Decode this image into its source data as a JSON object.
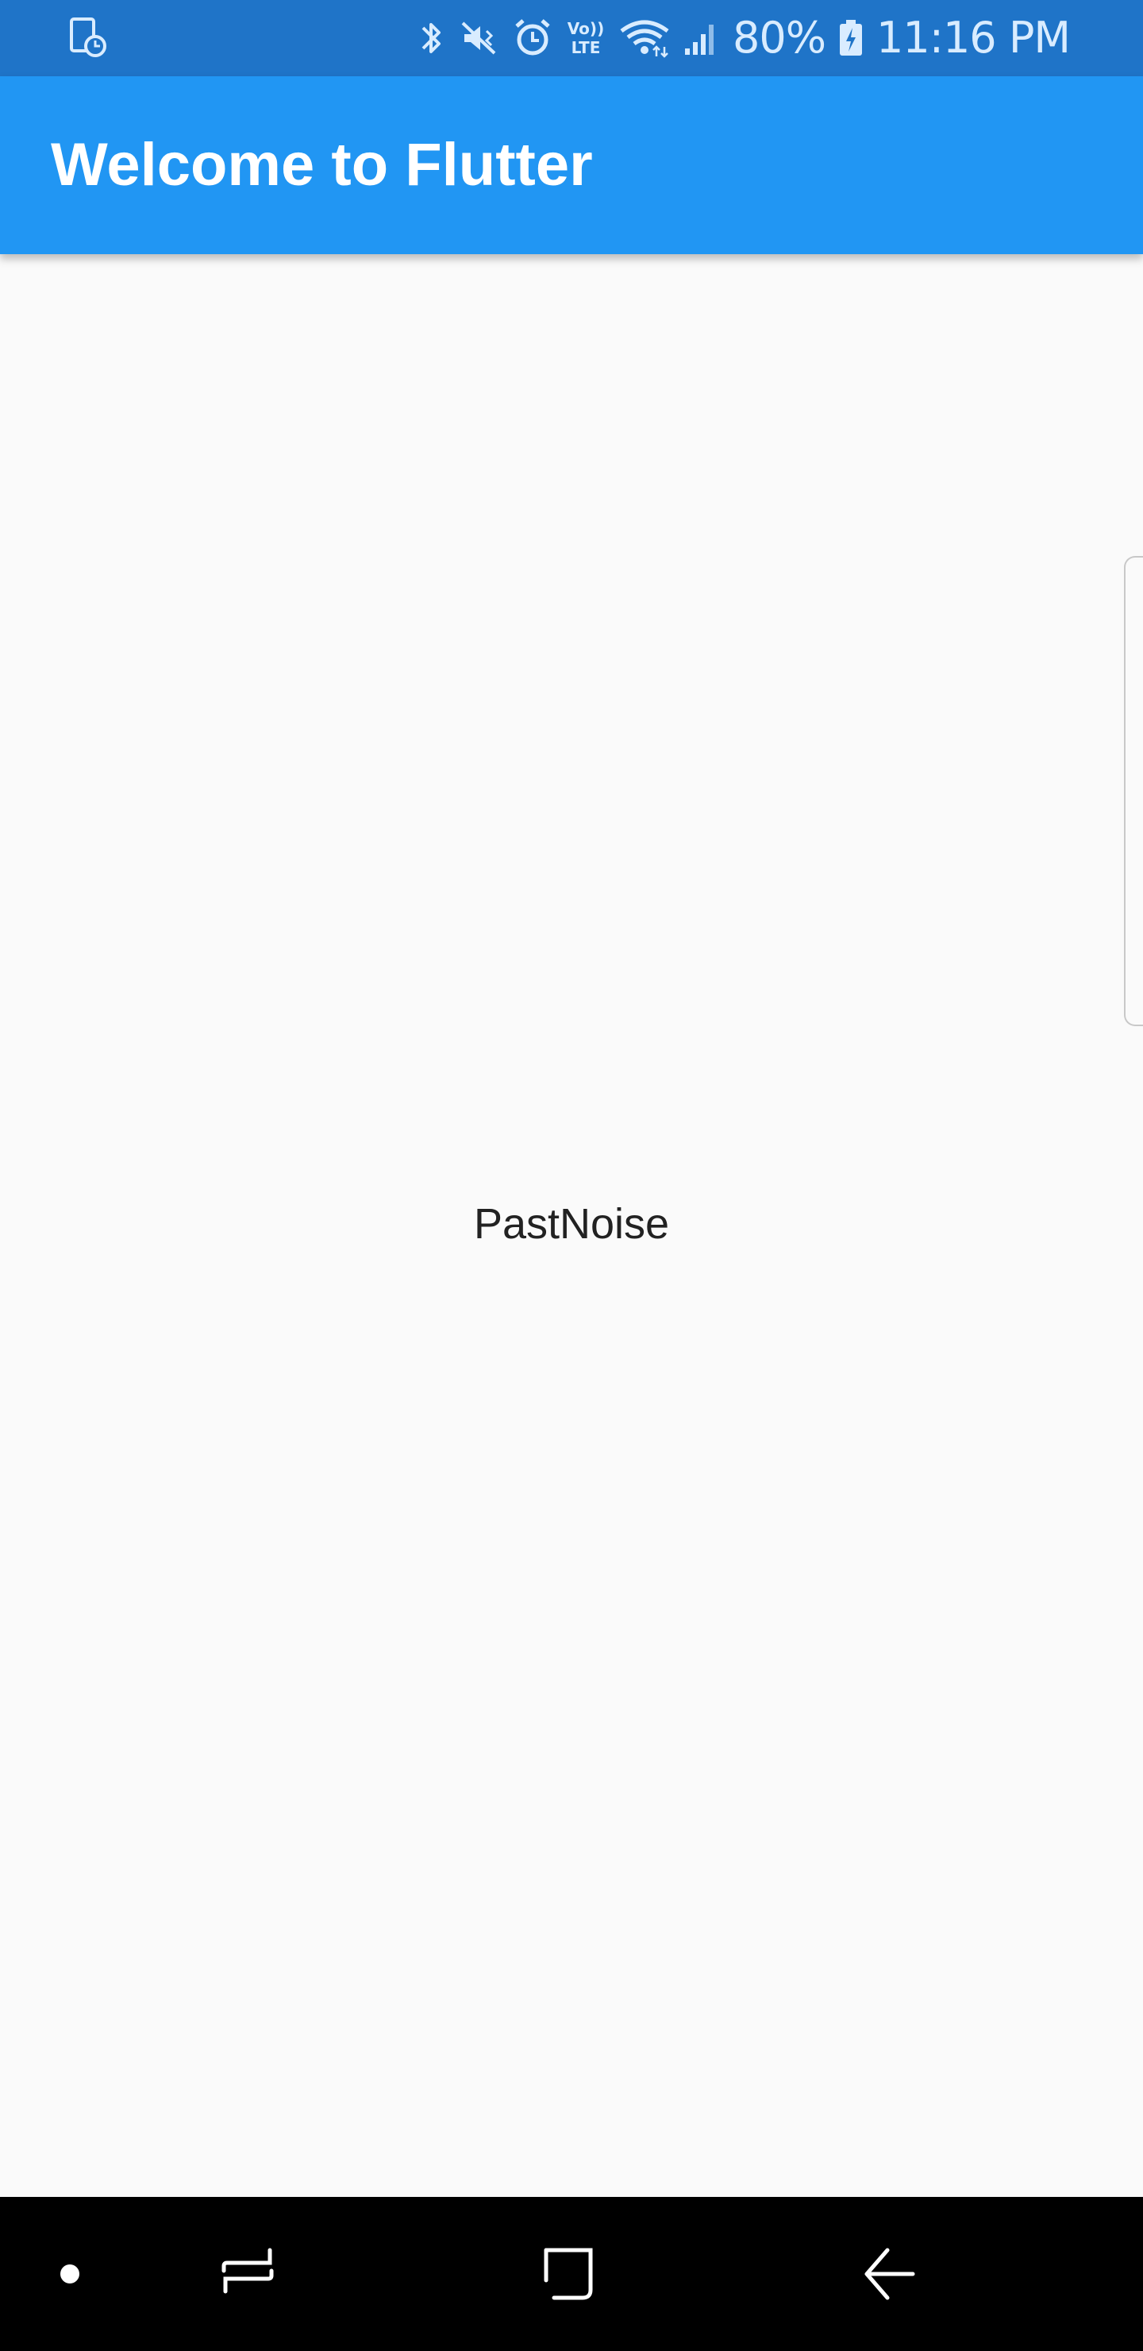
{
  "status_bar": {
    "battery_percent": "80%",
    "time": "11:16 PM",
    "icons": [
      "screen-timer-icon",
      "bluetooth-icon",
      "vibrate-icon",
      "alarm-icon",
      "volte-icon",
      "wifi-icon",
      "signal-icon",
      "battery-charging-icon"
    ],
    "volte_label_top": "Vo))",
    "volte_label_bottom": "LTE"
  },
  "app_bar": {
    "title": "Welcome to Flutter",
    "color": "#2196f3"
  },
  "content": {
    "center_text": "PastNoise"
  },
  "nav_bar": {
    "buttons": [
      "home-dot-icon",
      "recents-icon",
      "home-icon",
      "back-icon"
    ]
  },
  "colors": {
    "status_bar": "#1f74c8",
    "background": "#fafafa",
    "nav_bar": "#000000"
  }
}
